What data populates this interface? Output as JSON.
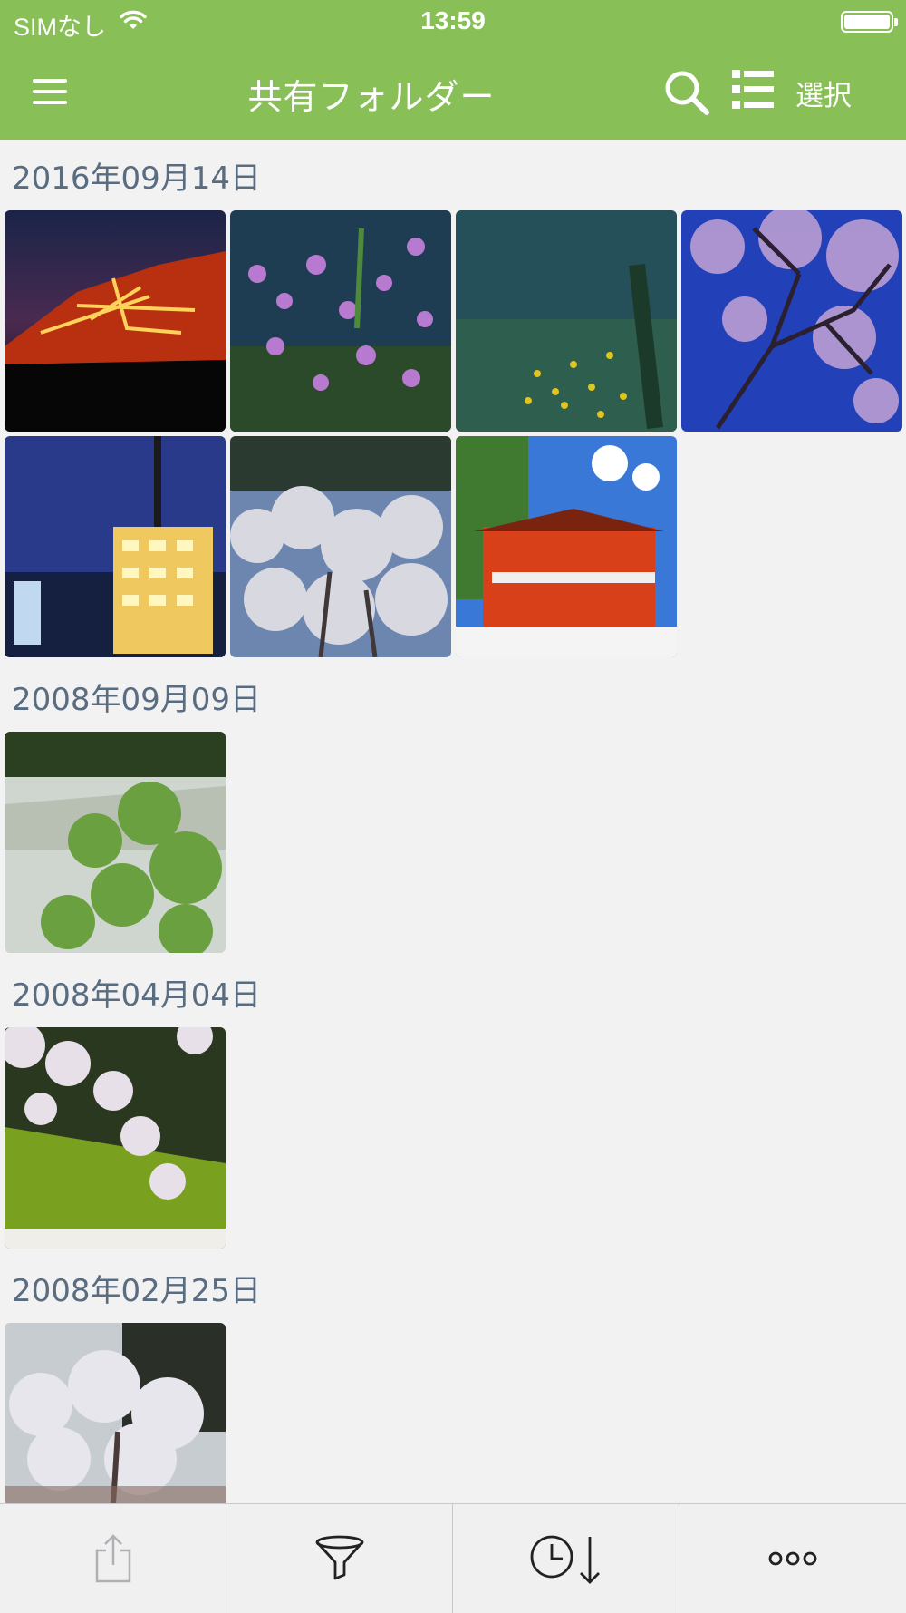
{
  "status_bar": {
    "carrier": "SIMなし",
    "time": "13:59"
  },
  "nav": {
    "title": "共有フォルダー",
    "select_label": "選択",
    "icons": [
      "menu-icon",
      "search-icon",
      "list-view-icon"
    ]
  },
  "sections": [
    {
      "date": "2016年09月14日",
      "photos": 7
    },
    {
      "date": "2008年09月09日",
      "photos": 1
    },
    {
      "date": "2008年04月04日",
      "photos": 1
    },
    {
      "date": "2008年02月25日",
      "photos": 1
    }
  ],
  "toolbar": {
    "items": [
      "share-icon",
      "filter-icon",
      "sort-by-time-icon",
      "more-icon"
    ]
  },
  "colors": {
    "accent": "#88bf57",
    "background": "#f2f2f3",
    "date_text": "#5a6d80"
  }
}
